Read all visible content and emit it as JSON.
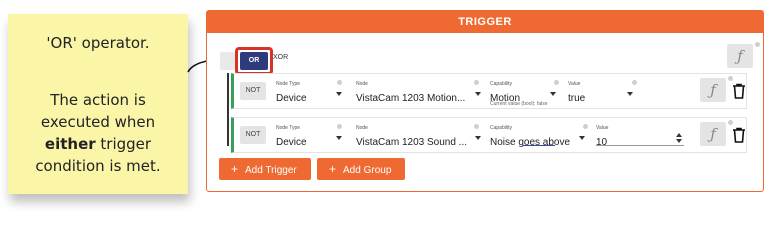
{
  "note": {
    "title": "'OR' operator.",
    "line1": "The action is",
    "line2": "executed when",
    "emph": "either",
    "line3_rest": " trigger",
    "line4": "condition is met."
  },
  "panel": {
    "header": "TRIGGER",
    "operator_or": "OR",
    "operator_xor": "XOR",
    "function_glyph": "ƒ"
  },
  "rows": [
    {
      "not_label": "NOT",
      "node_type_label": "Node Type",
      "node_type_value": "Device",
      "node_label": "Node",
      "node_value": "VistaCam 1203 Motion...",
      "capability_label": "Capability",
      "capability_value": "Motion",
      "capability_hint": "Current value (bool): false",
      "value_label": "Value",
      "value_value": "true"
    },
    {
      "not_label": "NOT",
      "node_type_label": "Node Type",
      "node_type_value": "Device",
      "node_label": "Node",
      "node_value": "VistaCam 1203 Sound ...",
      "capability_label": "Capability",
      "capability_value": "Noise goes above",
      "value_label": "Value",
      "value_value": "10"
    }
  ],
  "buttons": {
    "add_trigger": "Add Trigger",
    "add_group": "Add Group",
    "plus": "+"
  }
}
